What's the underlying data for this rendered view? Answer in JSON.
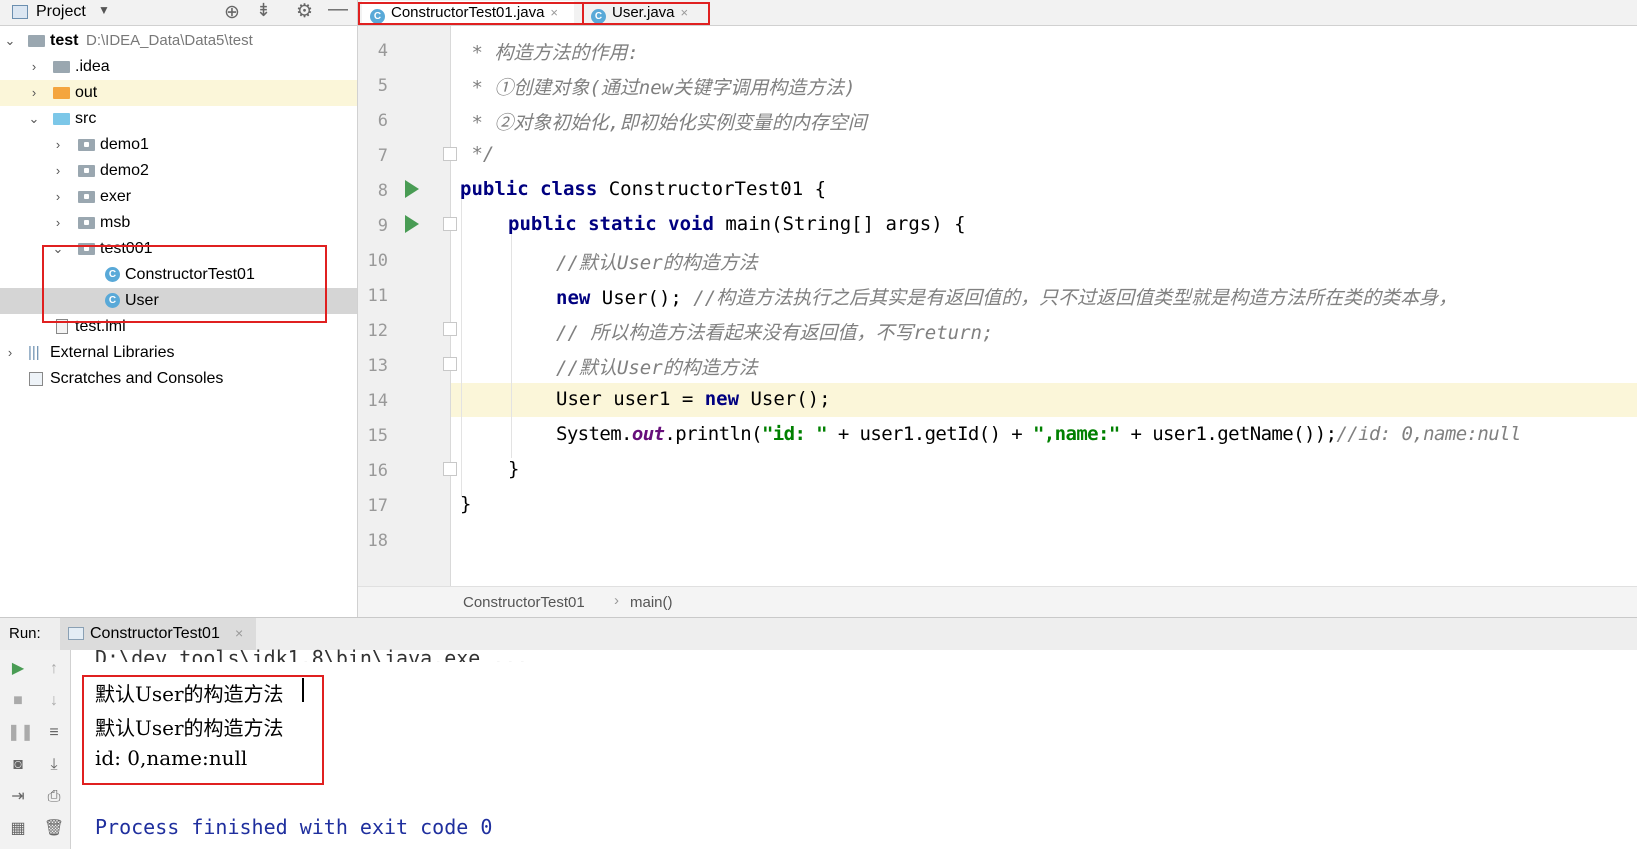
{
  "project_panel": {
    "title": "Project",
    "tree": [
      {
        "label": "test",
        "path": "D:\\IDEA_Data\\Data5\\test"
      },
      {
        "label": ".idea"
      },
      {
        "label": "out"
      },
      {
        "label": "src"
      },
      {
        "label": "demo1"
      },
      {
        "label": "demo2"
      },
      {
        "label": "exer"
      },
      {
        "label": "msb"
      },
      {
        "label": "test001"
      },
      {
        "label": "ConstructorTest01"
      },
      {
        "label": "User"
      },
      {
        "label": "test.iml"
      },
      {
        "label": "External Libraries"
      },
      {
        "label": "Scratches and Consoles"
      }
    ]
  },
  "tabs": [
    {
      "label": "ConstructorTest01.java",
      "active": true
    },
    {
      "label": "User.java",
      "active": false
    }
  ],
  "editor": {
    "lines": [
      {
        "num": "4",
        "text": " * 构造方法的作用:"
      },
      {
        "num": "5",
        "text": " * ①创建对象(通过new关键字调用构造方法)"
      },
      {
        "num": "6",
        "text": " * ②对象初始化,即初始化实例变量的内存空间"
      },
      {
        "num": "7",
        "text": " */"
      },
      {
        "num": "8",
        "kw1": "public class ",
        "text": "ConstructorTest01 {"
      },
      {
        "num": "9",
        "kw1": "public static void ",
        "text": "main(String[] args) {"
      },
      {
        "num": "10",
        "text": "//默认User的构造方法"
      },
      {
        "num": "11",
        "kw1": "new ",
        "text": "User(); ",
        "comment": "//构造方法执行之后其实是有返回值的，只不过返回值类型就是构造方法所在类的类本身，"
      },
      {
        "num": "12",
        "text": "// 所以构造方法看起来没有返回值，不写return;"
      },
      {
        "num": "13",
        "text": "//默认User的构造方法"
      },
      {
        "num": "14",
        "pre": "User user1 = ",
        "kw1": "new ",
        "text": "User();"
      },
      {
        "num": "15",
        "pre": "System.",
        "field": "out",
        "mid": ".println(",
        "str1": "\"id: \"",
        "mid2": " + user1.getId() + ",
        "str2": "\",name:\"",
        "mid3": " + user1.getName());",
        "comment": "//id: 0,name:null"
      },
      {
        "num": "16",
        "text": "}"
      },
      {
        "num": "17",
        "text": "}"
      },
      {
        "num": "18",
        "text": ""
      }
    ]
  },
  "breadcrumb": {
    "class": "ConstructorTest01",
    "method": "main()"
  },
  "run": {
    "label": "Run:",
    "tab": "ConstructorTest01",
    "output": [
      "D:\\dev_tools\\jdk1.8\\bin\\java.exe ...",
      "默认User的构造方法",
      "默认User的构造方法",
      "id: 0,name:null",
      "Process finished with exit code 0"
    ]
  }
}
